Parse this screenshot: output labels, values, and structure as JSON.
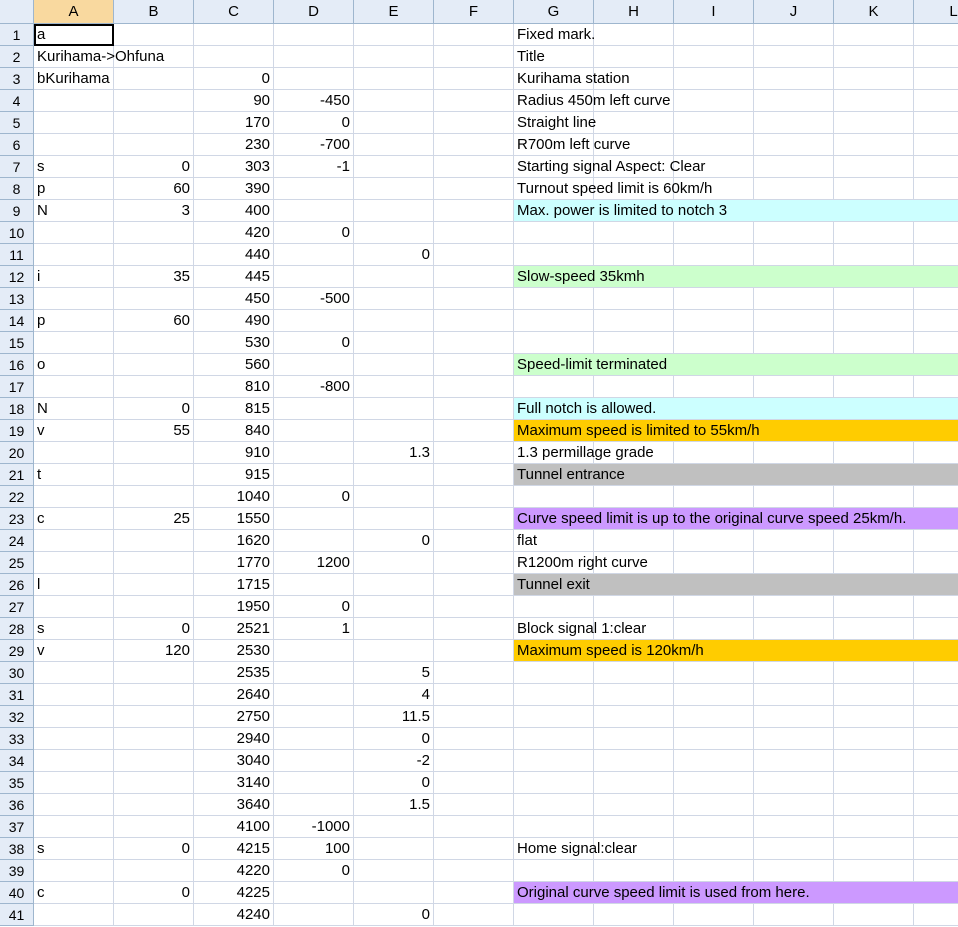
{
  "columns": [
    "A",
    "B",
    "C",
    "D",
    "E",
    "F",
    "G",
    "H",
    "I",
    "J",
    "K",
    "L"
  ],
  "selected_column": "A",
  "rows": [
    {
      "n": "1",
      "A": "a",
      "B": "",
      "C": "",
      "D": "",
      "E": "",
      "G": "Fixed mark.",
      "fill": ""
    },
    {
      "n": "2",
      "A": "Kurihama->Ohfuna",
      "B": "",
      "C": "",
      "D": "",
      "E": "",
      "G": "Title",
      "fill": ""
    },
    {
      "n": "3",
      "A": "bKurihama",
      "B": "",
      "C": "0",
      "D": "",
      "E": "",
      "G": "Kurihama station",
      "fill": ""
    },
    {
      "n": "4",
      "A": "",
      "B": "",
      "C": "90",
      "D": "-450",
      "E": "",
      "G": "Radius 450m left curve",
      "fill": ""
    },
    {
      "n": "5",
      "A": "",
      "B": "",
      "C": "170",
      "D": "0",
      "E": "",
      "G": "Straight line",
      "fill": ""
    },
    {
      "n": "6",
      "A": "",
      "B": "",
      "C": "230",
      "D": "-700",
      "E": "",
      "G": "R700m left curve",
      "fill": ""
    },
    {
      "n": "7",
      "A": "s",
      "B": "0",
      "C": "303",
      "D": "-1",
      "E": "",
      "G": "Starting signal  Aspect: Clear",
      "fill": ""
    },
    {
      "n": "8",
      "A": "p",
      "B": "60",
      "C": "390",
      "D": "",
      "E": "",
      "G": "Turnout   speed limit is 60km/h",
      "fill": ""
    },
    {
      "n": "9",
      "A": "N",
      "B": "3",
      "C": "400",
      "D": "",
      "E": "",
      "G": "Max. power is limited to notch 3",
      "fill": "#ccffff"
    },
    {
      "n": "10",
      "A": "",
      "B": "",
      "C": "420",
      "D": "0",
      "E": "",
      "G": "",
      "fill": ""
    },
    {
      "n": "11",
      "A": "",
      "B": "",
      "C": "440",
      "D": "",
      "E": "0",
      "G": "",
      "fill": ""
    },
    {
      "n": "12",
      "A": "i",
      "B": "35",
      "C": "445",
      "D": "",
      "E": "",
      "G": "Slow-speed 35kmh",
      "fill": "#ccffcc"
    },
    {
      "n": "13",
      "A": "",
      "B": "",
      "C": "450",
      "D": "-500",
      "E": "",
      "G": "",
      "fill": ""
    },
    {
      "n": "14",
      "A": "p",
      "B": "60",
      "C": "490",
      "D": "",
      "E": "",
      "G": "",
      "fill": ""
    },
    {
      "n": "15",
      "A": "",
      "B": "",
      "C": "530",
      "D": "0",
      "E": "",
      "G": "",
      "fill": ""
    },
    {
      "n": "16",
      "A": "o",
      "B": "",
      "C": "560",
      "D": "",
      "E": "",
      "G": "Speed-limit terminated",
      "fill": "#ccffcc"
    },
    {
      "n": "17",
      "A": "",
      "B": "",
      "C": "810",
      "D": "-800",
      "E": "",
      "G": "",
      "fill": ""
    },
    {
      "n": "18",
      "A": "N",
      "B": "0",
      "C": "815",
      "D": "",
      "E": "",
      "G": "Full notch is allowed.",
      "fill": "#ccffff"
    },
    {
      "n": "19",
      "A": "v",
      "B": "55",
      "C": "840",
      "D": "",
      "E": "",
      "G": "Maximum speed is limited to 55km/h",
      "fill": "#ffcc00"
    },
    {
      "n": "20",
      "A": "",
      "B": "",
      "C": "910",
      "D": "",
      "E": "1.3",
      "G": "1.3 permillage grade",
      "fill": ""
    },
    {
      "n": "21",
      "A": "t",
      "B": "",
      "C": "915",
      "D": "",
      "E": "",
      "G": "Tunnel entrance",
      "fill": "#c0c0c0"
    },
    {
      "n": "22",
      "A": "",
      "B": "",
      "C": "1040",
      "D": "0",
      "E": "",
      "G": "",
      "fill": ""
    },
    {
      "n": "23",
      "A": "c",
      "B": "25",
      "C": "1550",
      "D": "",
      "E": "",
      "G": "Curve speed limit is up to the original curve speed 25km/h.",
      "fill": "#cc99ff"
    },
    {
      "n": "24",
      "A": "",
      "B": "",
      "C": "1620",
      "D": "",
      "E": "0",
      "G": "flat",
      "fill": ""
    },
    {
      "n": "25",
      "A": "",
      "B": "",
      "C": "1770",
      "D": "1200",
      "E": "",
      "G": "R1200m right curve",
      "fill": ""
    },
    {
      "n": "26",
      "A": "l",
      "B": "",
      "C": "1715",
      "D": "",
      "E": "",
      "G": "Tunnel exit",
      "fill": "#c0c0c0"
    },
    {
      "n": "27",
      "A": "",
      "B": "",
      "C": "1950",
      "D": "0",
      "E": "",
      "G": "",
      "fill": ""
    },
    {
      "n": "28",
      "A": "s",
      "B": "0",
      "C": "2521",
      "D": "1",
      "E": "",
      "G": "Block signal 1:clear",
      "fill": ""
    },
    {
      "n": "29",
      "A": "v",
      "B": "120",
      "C": "2530",
      "D": "",
      "E": "",
      "G": "Maximum speed is 120km/h",
      "fill": "#ffcc00"
    },
    {
      "n": "30",
      "A": "",
      "B": "",
      "C": "2535",
      "D": "",
      "E": "5",
      "G": "",
      "fill": ""
    },
    {
      "n": "31",
      "A": "",
      "B": "",
      "C": "2640",
      "D": "",
      "E": "4",
      "G": "",
      "fill": ""
    },
    {
      "n": "32",
      "A": "",
      "B": "",
      "C": "2750",
      "D": "",
      "E": "11.5",
      "G": "",
      "fill": ""
    },
    {
      "n": "33",
      "A": "",
      "B": "",
      "C": "2940",
      "D": "",
      "E": "0",
      "G": "",
      "fill": ""
    },
    {
      "n": "34",
      "A": "",
      "B": "",
      "C": "3040",
      "D": "",
      "E": "-2",
      "G": "",
      "fill": ""
    },
    {
      "n": "35",
      "A": "",
      "B": "",
      "C": "3140",
      "D": "",
      "E": "0",
      "G": "",
      "fill": ""
    },
    {
      "n": "36",
      "A": "",
      "B": "",
      "C": "3640",
      "D": "",
      "E": "1.5",
      "G": "",
      "fill": ""
    },
    {
      "n": "37",
      "A": "",
      "B": "",
      "C": "4100",
      "D": "-1000",
      "E": "",
      "G": "",
      "fill": ""
    },
    {
      "n": "38",
      "A": "s",
      "B": "0",
      "C": "4215",
      "D": "100",
      "E": "",
      "G": "Home signal:clear",
      "fill": ""
    },
    {
      "n": "39",
      "A": "",
      "B": "",
      "C": "4220",
      "D": "0",
      "E": "",
      "G": "",
      "fill": ""
    },
    {
      "n": "40",
      "A": "c",
      "B": "0",
      "C": "4225",
      "D": "",
      "E": "",
      "G": "Original curve speed limit is used from here.",
      "fill": "#cc99ff"
    },
    {
      "n": "41",
      "A": "",
      "B": "",
      "C": "4240",
      "D": "",
      "E": "0",
      "G": "",
      "fill": ""
    }
  ]
}
